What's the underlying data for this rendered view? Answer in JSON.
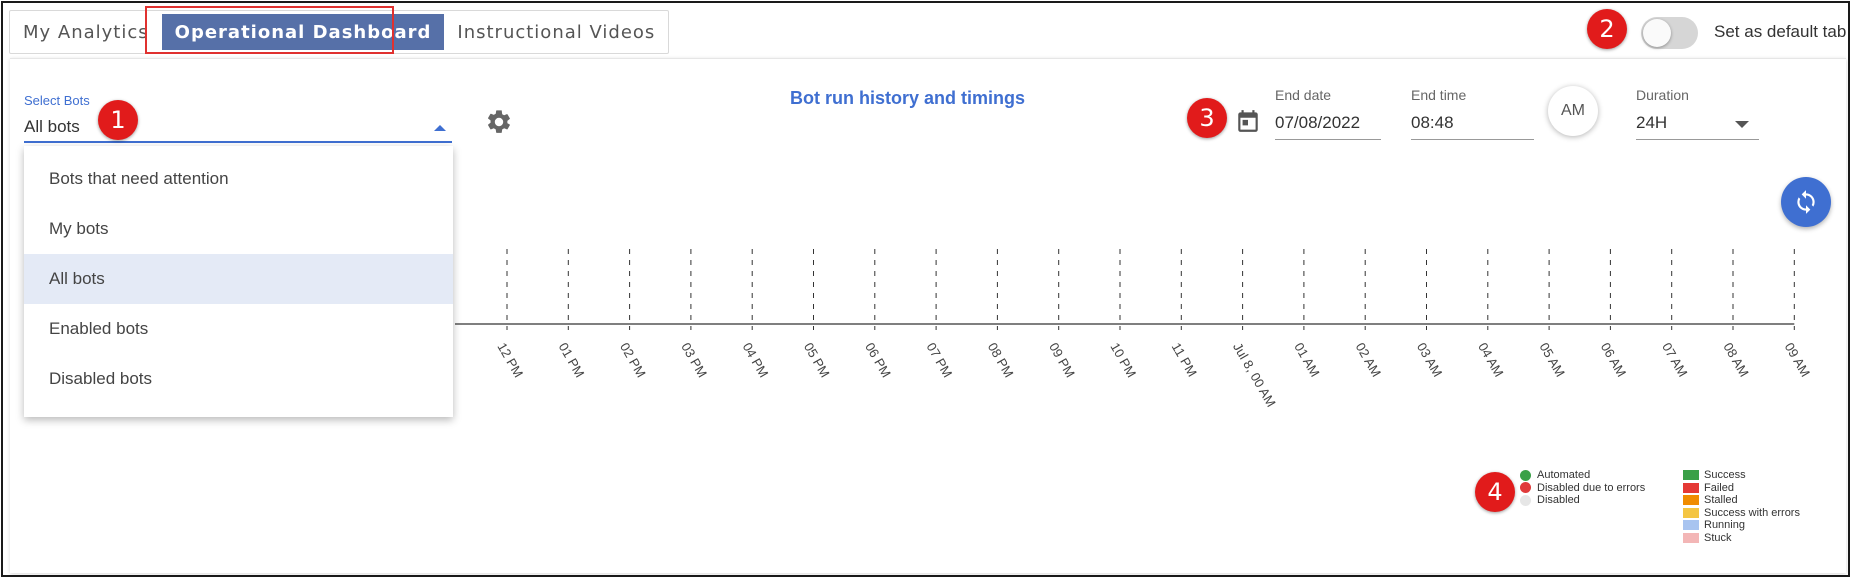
{
  "tabs": [
    {
      "label": "My Analytics"
    },
    {
      "label": "Operational Dashboard"
    },
    {
      "label": "Instructional Videos"
    }
  ],
  "default_tab": {
    "label": "Set as default tab",
    "enabled": false
  },
  "select_bots": {
    "label": "Select Bots",
    "value": "All bots"
  },
  "bot_options": [
    {
      "label": "Bots that need attention"
    },
    {
      "label": "My bots"
    },
    {
      "label": "All bots",
      "selected": true
    },
    {
      "label": "Enabled bots"
    },
    {
      "label": "Disabled bots"
    }
  ],
  "chart_title": "Bot run history and timings",
  "end_date": {
    "label": "End date",
    "value": "07/08/2022"
  },
  "end_time": {
    "label": "End time",
    "value": "08:48"
  },
  "meridiem": "AM",
  "duration": {
    "label": "Duration",
    "value": "24H"
  },
  "icons": {
    "settings": "gear-icon",
    "calendar": "calendar-icon",
    "refresh": "refresh-icon"
  },
  "badges": [
    "1",
    "2",
    "3",
    "4"
  ],
  "chart_data": {
    "type": "timeline",
    "x_ticks": [
      "12 PM",
      "01 PM",
      "02 PM",
      "03 PM",
      "04 PM",
      "05 PM",
      "06 PM",
      "07 PM",
      "08 PM",
      "09 PM",
      "10 PM",
      "11 PM",
      "Jul 8, 00 AM",
      "01 AM",
      "02 AM",
      "03 AM",
      "04 AM",
      "05 AM",
      "06 AM",
      "07 AM",
      "08 AM",
      "09 AM"
    ],
    "series": []
  },
  "legend": {
    "status": [
      {
        "label": "Automated",
        "color": "#3aa047"
      },
      {
        "label": "Disabled due to errors",
        "color": "#e03a3a"
      },
      {
        "label": "Disabled",
        "color": "#e6e6e6"
      }
    ],
    "run": [
      {
        "label": "Success",
        "color": "#3aa047"
      },
      {
        "label": "Failed",
        "color": "#e53935"
      },
      {
        "label": "Stalled",
        "color": "#f08c00"
      },
      {
        "label": "Success with errors",
        "color": "#f4c542"
      },
      {
        "label": "Running",
        "color": "#a8c4f0"
      },
      {
        "label": "Stuck",
        "color": "#f3b6b6"
      }
    ]
  }
}
